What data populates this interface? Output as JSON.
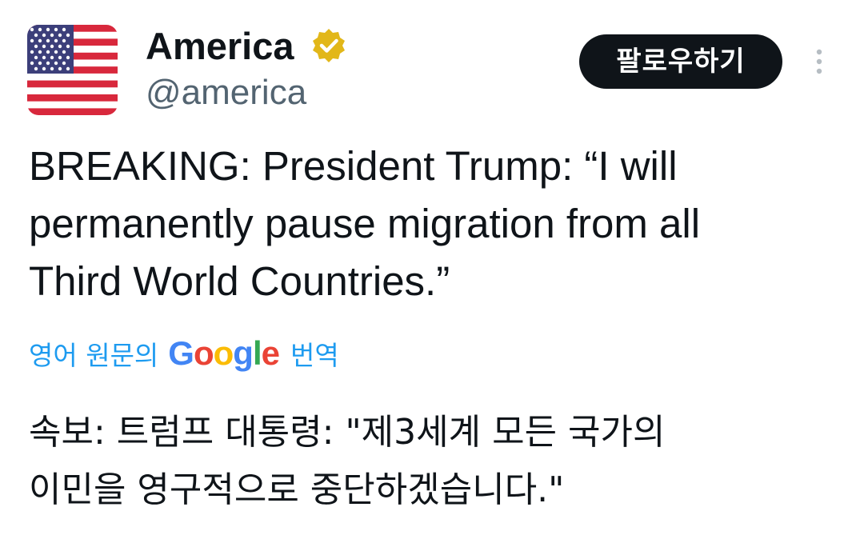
{
  "tweet": {
    "author": {
      "display_name": "America",
      "handle": "@america",
      "verified": true,
      "verified_badge_color": "#e2b719",
      "avatar_icon": "us-flag-icon"
    },
    "follow_button_label": "팔로우하기",
    "more_icon": "more-vertical-icon",
    "text_lines": [
      "BREAKING: President Trump: “I will",
      "permanently pause migration from all",
      "Third World Countries.”"
    ],
    "translation": {
      "prefix": "영어 원문의",
      "brand": "Google",
      "suffix": "번역",
      "link_color": "#1d9bf0",
      "translated_lines": [
        "속보: 트럼프 대통령: \"제3세계 모든 국가의",
        "이민을 영구적으로 중단하겠습니다.\""
      ]
    }
  }
}
